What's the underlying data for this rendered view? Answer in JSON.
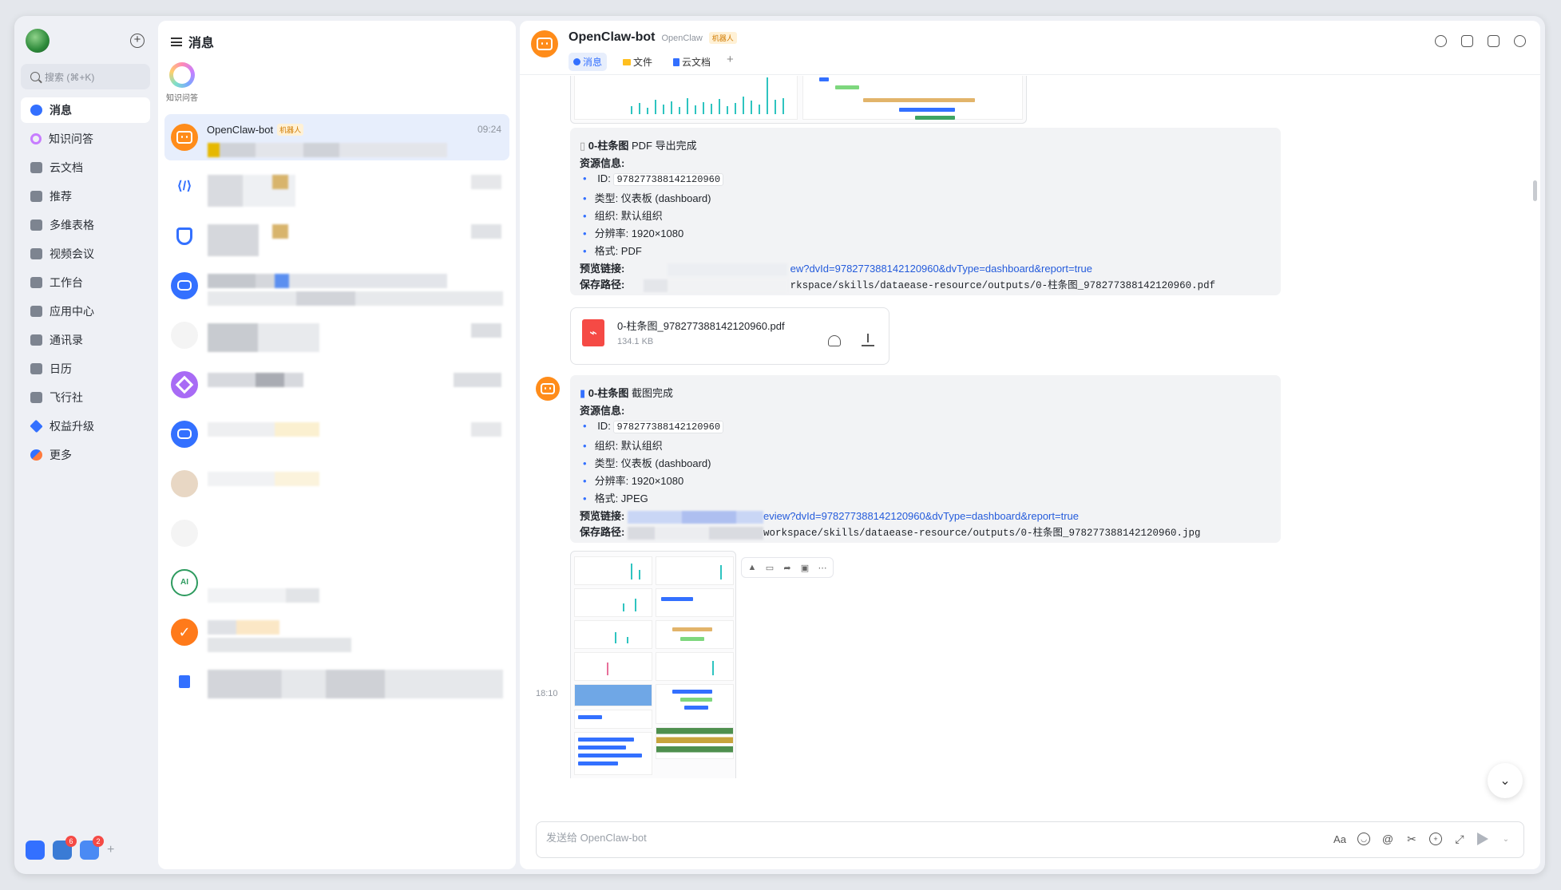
{
  "nav": {
    "search_placeholder": "搜索 (⌘+K)",
    "items": [
      {
        "label": "消息",
        "icon": "message-icon"
      },
      {
        "label": "知识问答",
        "icon": "knowledge-icon"
      },
      {
        "label": "云文档",
        "icon": "doc-icon"
      },
      {
        "label": "推荐",
        "icon": "recommend-icon"
      },
      {
        "label": "多维表格",
        "icon": "base-icon"
      },
      {
        "label": "视频会议",
        "icon": "video-icon"
      },
      {
        "label": "工作台",
        "icon": "workplace-icon"
      },
      {
        "label": "应用中心",
        "icon": "app-center-icon"
      },
      {
        "label": "通讯录",
        "icon": "contacts-icon"
      },
      {
        "label": "日历",
        "icon": "calendar-icon"
      },
      {
        "label": "飞行社",
        "icon": "community-icon"
      },
      {
        "label": "权益升级",
        "icon": "upgrade-icon"
      },
      {
        "label": "更多",
        "icon": "more-icon"
      }
    ],
    "bottom_apps": [
      {
        "badge": ""
      },
      {
        "badge": "6"
      },
      {
        "badge": "2"
      }
    ]
  },
  "list": {
    "title": "消息",
    "shortcut_label": "知识问答",
    "active_chat": {
      "name": "OpenClaw-bot",
      "tag": "机器人",
      "time": "09:24"
    }
  },
  "conv": {
    "name": "OpenClaw-bot",
    "org": "OpenClaw",
    "tag": "机器人",
    "tabs": [
      "消息",
      "文件",
      "云文档"
    ],
    "pdf_card": {
      "title_bold": "0-柱条图",
      "title_rest": " PDF 导出完成",
      "section": "资源信息:",
      "id_label": "ID:",
      "id_value": "978277388142120960",
      "type": "类型: 仪表板 (dashboard)",
      "org": "组织: 默认组织",
      "res": "分辨率: 1920×1080",
      "fmt": "格式: PDF",
      "preview_label": "预览链接:",
      "preview_link": "ew?dvId=978277388142120960&dvType=dashboard&report=true",
      "save_label": "保存路径:",
      "save_path": "rkspace/skills/dataease-resource/outputs/0-柱条图_978277388142120960.pdf"
    },
    "file": {
      "name": "0-柱条图_978277388142120960.pdf",
      "size": "134.1 KB"
    },
    "jpg_card": {
      "title_bold": "0-柱条图",
      "title_rest": " 截图完成",
      "section": "资源信息:",
      "id_label": "ID:",
      "id_value": "978277388142120960",
      "org": "组织: 默认组织",
      "type": "类型: 仪表板 (dashboard)",
      "res": "分辨率: 1920×1080",
      "fmt": "格式: JPEG",
      "preview_label": "预览链接:",
      "preview_link": "eview?dvId=978277388142120960&dvType=dashboard&report=true",
      "save_label": "保存路径:",
      "save_path": "workspace/skills/dataease-resource/outputs/0-柱条图_978277388142120960.jpg"
    },
    "timestamp": "18:10",
    "composer_placeholder": "发送给 OpenClaw-bot"
  }
}
